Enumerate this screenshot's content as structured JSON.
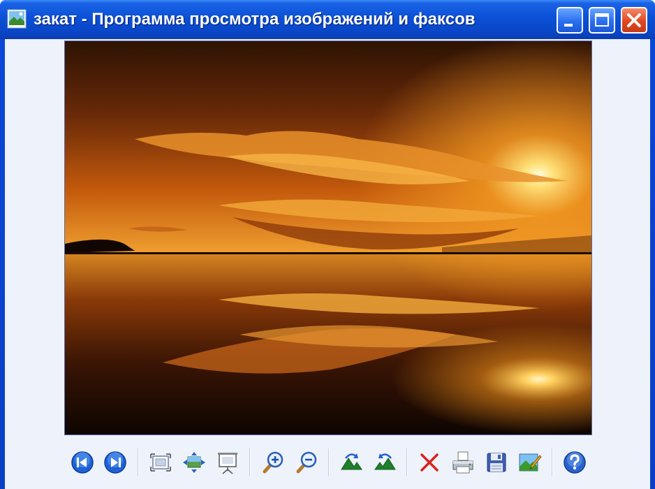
{
  "window": {
    "title": "закат - Программа просмотра изображений и факсов"
  },
  "caption_buttons": [
    {
      "name": "minimize",
      "icon": "minimize-icon"
    },
    {
      "name": "maximize",
      "icon": "maximize-icon"
    },
    {
      "name": "close",
      "icon": "close-icon"
    }
  ],
  "image": {
    "description_icon": "sunset-photo",
    "colors": {
      "sky_top": "#3a1806",
      "sky_glow": "#e9861a",
      "sun": "#fff6c8",
      "water_dark": "#0f0602"
    }
  },
  "toolbar": [
    {
      "name": "previous-image",
      "icon": "previous-icon"
    },
    {
      "name": "next-image",
      "icon": "next-icon"
    },
    {
      "name": "best-fit",
      "icon": "best-fit-icon"
    },
    {
      "name": "actual-size",
      "icon": "actual-size-icon"
    },
    {
      "name": "slideshow",
      "icon": "slideshow-icon"
    },
    {
      "name": "zoom-in",
      "icon": "zoom-in-icon"
    },
    {
      "name": "zoom-out",
      "icon": "zoom-out-icon"
    },
    {
      "name": "rotate-clockwise",
      "icon": "rotate-clockwise-icon"
    },
    {
      "name": "rotate-counterclockwise",
      "icon": "rotate-counterclockwise-icon"
    },
    {
      "name": "delete",
      "icon": "delete-icon"
    },
    {
      "name": "print",
      "icon": "print-icon"
    },
    {
      "name": "save",
      "icon": "save-icon"
    },
    {
      "name": "edit",
      "icon": "edit-icon"
    },
    {
      "name": "help",
      "icon": "help-icon"
    }
  ]
}
